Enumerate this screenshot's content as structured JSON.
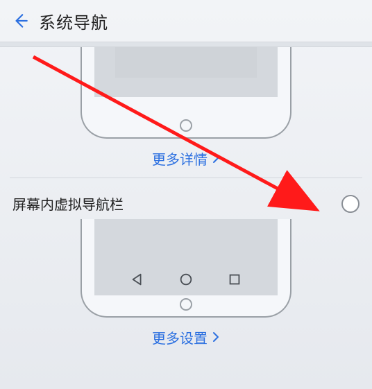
{
  "header": {
    "title": "系统导航"
  },
  "section_top": {
    "more_label": "更多详情"
  },
  "option": {
    "label": "屏幕内虚拟导航栏",
    "selected": false
  },
  "section_bottom": {
    "more_label": "更多设置"
  },
  "icons": {
    "back": "back-arrow-icon",
    "chevron": "chevron-right-icon",
    "nav_back": "triangle-back-icon",
    "nav_home": "circle-home-icon",
    "nav_recent": "square-recent-icon"
  }
}
